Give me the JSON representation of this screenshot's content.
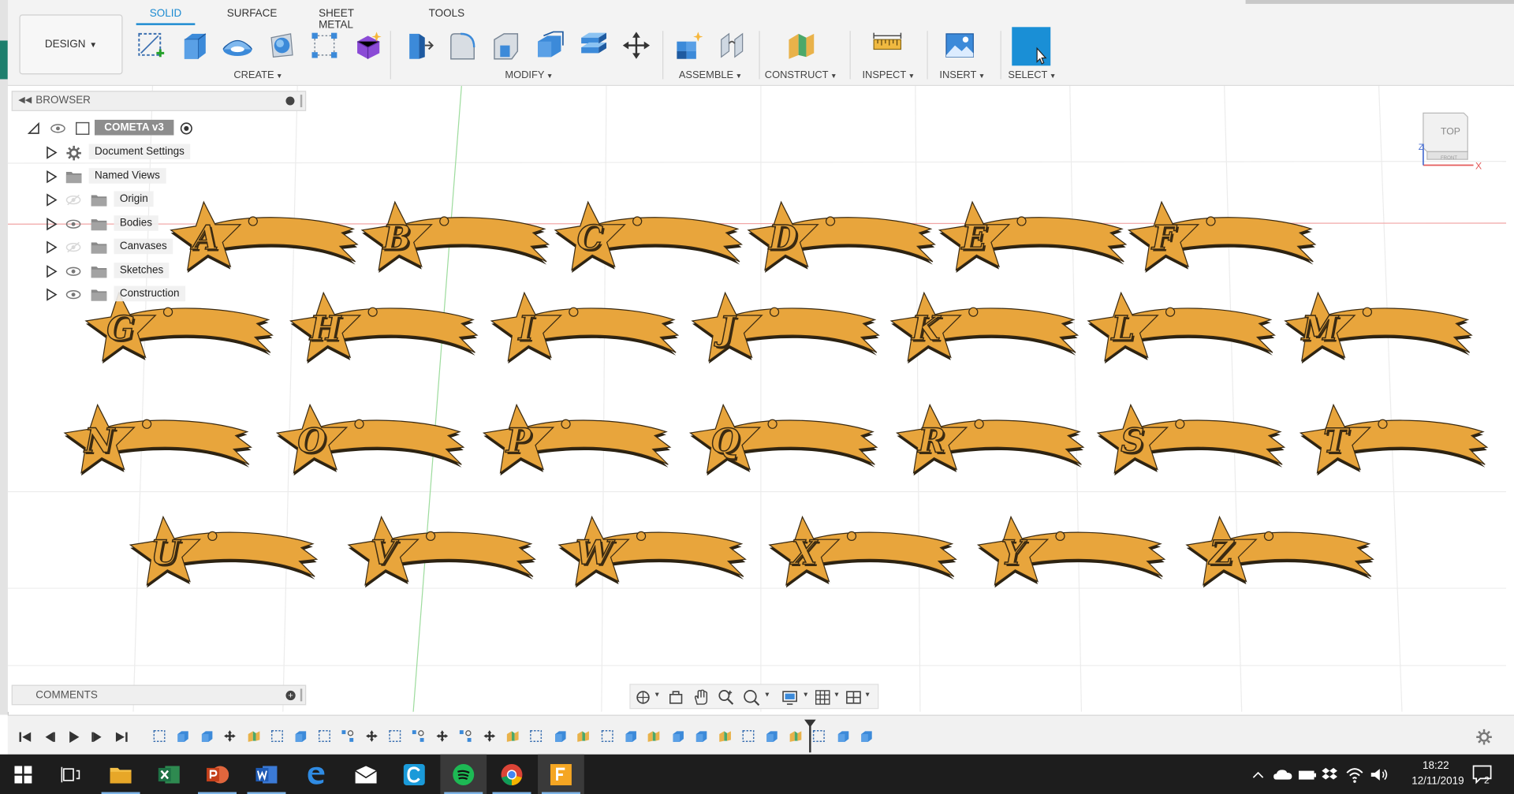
{
  "toolbar": {
    "design_button": "DESIGN",
    "tabs": [
      {
        "label": "SOLID",
        "active": true
      },
      {
        "label": "SURFACE",
        "active": false
      },
      {
        "label": "SHEET METAL",
        "active": false
      },
      {
        "label": "TOOLS",
        "active": false
      }
    ],
    "groups": {
      "create": "CREATE",
      "modify": "MODIFY",
      "assemble": "ASSEMBLE",
      "construct": "CONSTRUCT",
      "inspect": "INSPECT",
      "insert": "INSERT",
      "select": "SELECT"
    }
  },
  "browser": {
    "title": "BROWSER",
    "root": "COMETA v3",
    "items": [
      {
        "label": "Document Settings",
        "icon": "gear-icon"
      },
      {
        "label": "Named Views",
        "icon": "folder-icon"
      },
      {
        "label": "Origin",
        "icon": "folder-icon",
        "visible": false
      },
      {
        "label": "Bodies",
        "icon": "folder-icon",
        "visible": true
      },
      {
        "label": "Canvases",
        "icon": "folder-icon",
        "visible": false
      },
      {
        "label": "Sketches",
        "icon": "folder-icon",
        "visible": true
      },
      {
        "label": "Construction",
        "icon": "folder-icon",
        "visible": true
      }
    ]
  },
  "viewcube": {
    "face": "TOP",
    "front": "FRONT",
    "axis_x": "X",
    "axis_z": "Z"
  },
  "model": {
    "rows": [
      [
        "A",
        "B",
        "C",
        "D",
        "E",
        "F"
      ],
      [
        "G",
        "H",
        "I",
        "J",
        "K",
        "L",
        "M"
      ],
      [
        "N",
        "O",
        "P",
        "Q",
        "R",
        "S",
        "T"
      ],
      [
        "U",
        "V",
        "W",
        "X",
        "Y",
        "Z"
      ]
    ],
    "body_color": "#e8a53c",
    "edge_color": "#3a2a12"
  },
  "comments": {
    "title": "COMMENTS"
  },
  "taskbar": {
    "time": "18:22",
    "date": "12/11/2019",
    "notifications": "2",
    "apps": [
      "start-icon",
      "task-view-icon",
      "file-explorer-icon",
      "excel-icon",
      "powerpoint-icon",
      "word-icon",
      "edge-icon",
      "mail-icon",
      "ccleaner-icon",
      "spotify-icon",
      "chrome-icon",
      "fusion360-icon"
    ]
  },
  "colors": {
    "accent": "#1b8ad1",
    "taskbar": "#1d1d1d",
    "select_blue": "#1a8fd6"
  }
}
